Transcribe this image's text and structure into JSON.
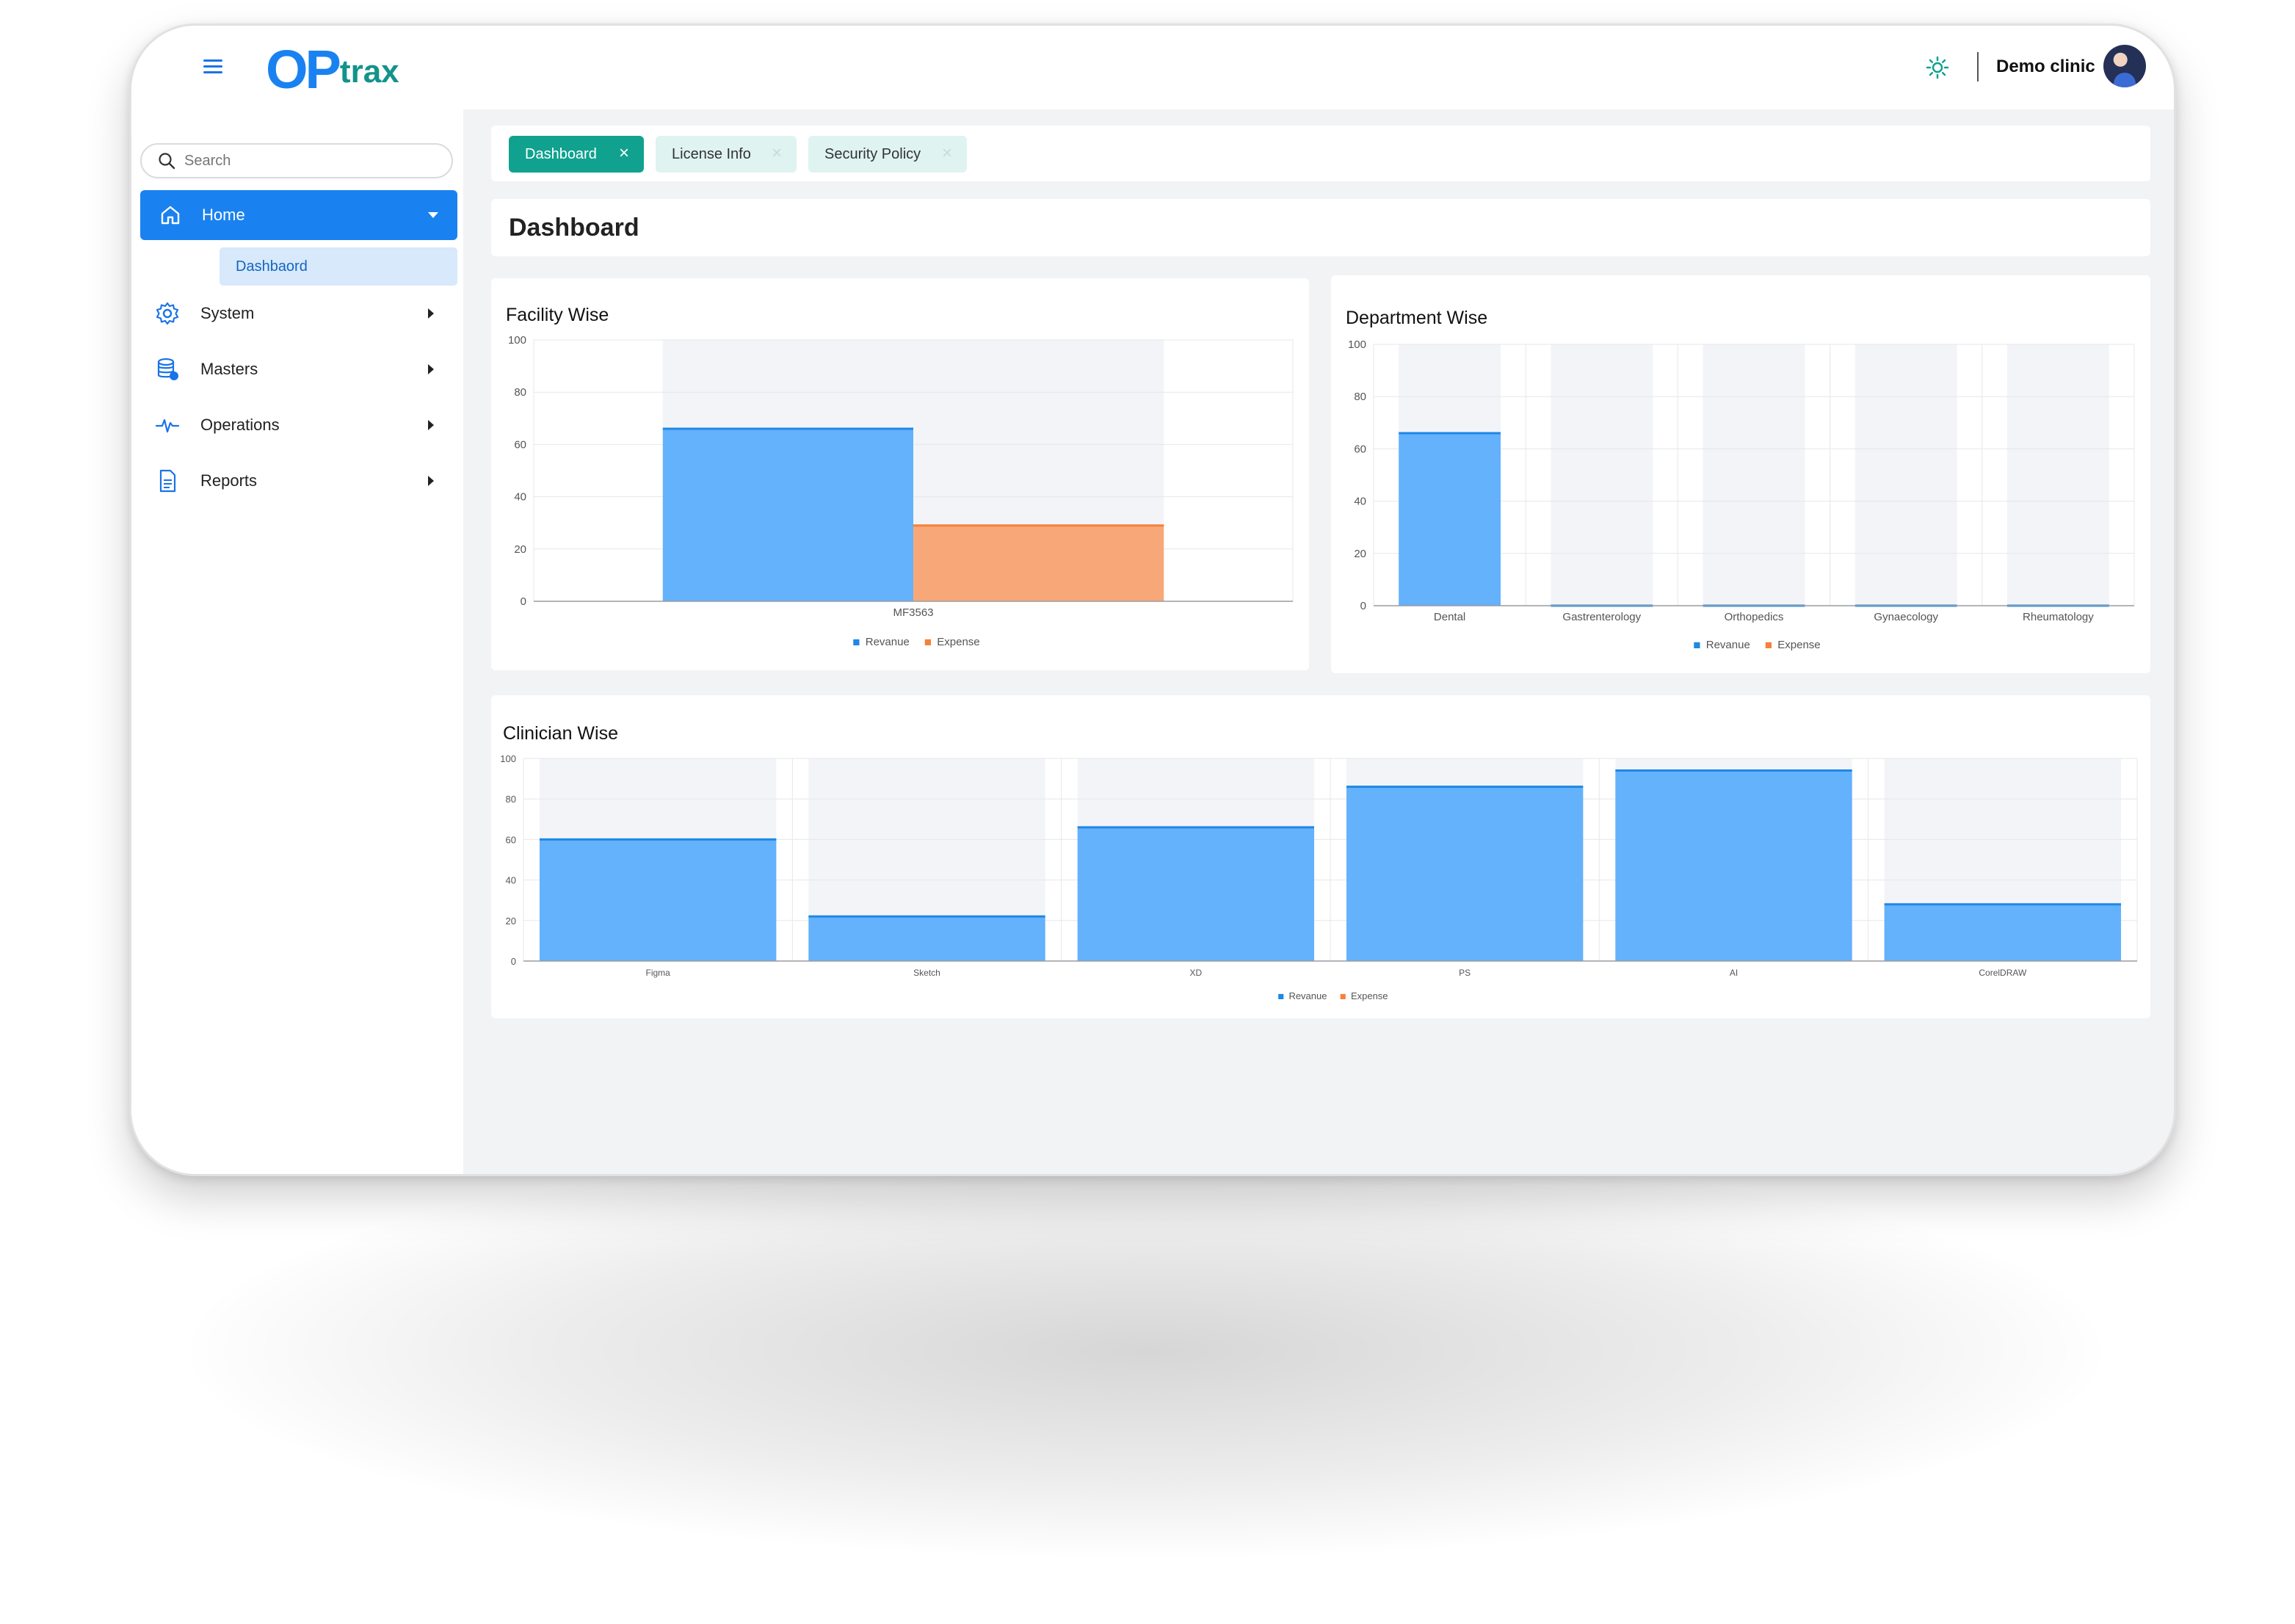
{
  "header": {
    "logo_op": "OP",
    "logo_trax": "trax",
    "clinic_name": "Demo clinic"
  },
  "sidebar": {
    "search_placeholder": "Search",
    "items": [
      {
        "label": "Home",
        "icon": "home-icon",
        "expanded": true
      },
      {
        "label": "System",
        "icon": "gear-icon"
      },
      {
        "label": "Masters",
        "icon": "database-icon"
      },
      {
        "label": "Operations",
        "icon": "pulse-icon"
      },
      {
        "label": "Reports",
        "icon": "document-icon"
      }
    ],
    "sub_items": [
      {
        "label": "Dashbaord"
      }
    ]
  },
  "tabs": [
    {
      "label": "Dashboard",
      "active": true
    },
    {
      "label": "License Info",
      "active": false
    },
    {
      "label": "Security Policy",
      "active": false
    }
  ],
  "page_title": "Dashboard",
  "colors": {
    "primary": "#1a82f0",
    "teal": "#10a28f",
    "revenue": "#1e88e5",
    "revenue_fill": "#64b1fc",
    "expense": "#f5813a",
    "expense_fill": "#f8a878"
  },
  "chart_data": [
    {
      "type": "bar",
      "title": "Facility Wise",
      "categories": [
        "MF3563"
      ],
      "series": [
        {
          "name": "Revanue",
          "values": [
            66
          ]
        },
        {
          "name": "Expense",
          "values": [
            29
          ]
        }
      ],
      "ylim": [
        0,
        100
      ],
      "yticks": [
        0,
        20,
        40,
        60,
        80,
        100
      ],
      "grid": true,
      "legend": "bottom"
    },
    {
      "type": "bar",
      "title": "Department Wise",
      "categories": [
        "Dental",
        "Gastrenterology",
        "Orthopedics",
        "Gynaecology",
        "Rheumatology"
      ],
      "series": [
        {
          "name": "Revanue",
          "values": [
            66,
            0,
            0,
            0,
            0
          ]
        },
        {
          "name": "Expense",
          "values": [
            0,
            0,
            0,
            0,
            0
          ]
        }
      ],
      "ylim": [
        0,
        100
      ],
      "yticks": [
        0,
        20,
        40,
        60,
        80,
        100
      ],
      "grid": true,
      "legend": "bottom"
    },
    {
      "type": "bar",
      "title": "Clinician Wise",
      "categories": [
        "Figma",
        "Sketch",
        "XD",
        "PS",
        "AI",
        "CorelDRAW"
      ],
      "series": [
        {
          "name": "Revanue",
          "values": [
            60,
            22,
            66,
            86,
            94,
            28
          ]
        },
        {
          "name": "Expense",
          "values": [
            0,
            0,
            0,
            0,
            0,
            0
          ]
        }
      ],
      "ylim": [
        0,
        100
      ],
      "yticks": [
        0,
        20,
        40,
        60,
        80,
        100
      ],
      "grid": true,
      "legend": "bottom"
    }
  ]
}
